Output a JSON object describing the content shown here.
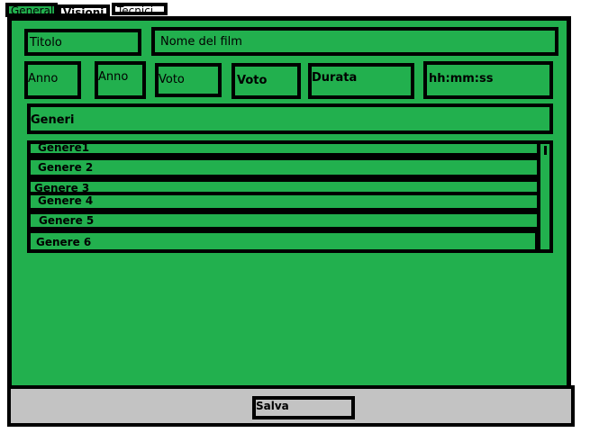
{
  "tabs": [
    {
      "label": "Generale",
      "active": true
    },
    {
      "label": "Visioni",
      "active": false
    },
    {
      "label": "Tecnici",
      "active": false
    }
  ],
  "form": {
    "titolo_label": "Titolo",
    "titolo_value": "Nome del film",
    "anno_label": "Anno",
    "anno_value": "Anno",
    "voto_label": "Voto",
    "voto_value": "Voto",
    "durata_label": "Durata",
    "durata_value": "hh:mm:ss",
    "generi_label": "Generi"
  },
  "genres": [
    "Genere1",
    "Genere 2",
    "Genere 3",
    "Genere 4",
    "Genere 5",
    "Genere 6"
  ],
  "footer": {
    "save_label": "Salva"
  },
  "colors": {
    "panel": "#22b04e",
    "footer": "#c3c3c3",
    "border": "#000000"
  }
}
